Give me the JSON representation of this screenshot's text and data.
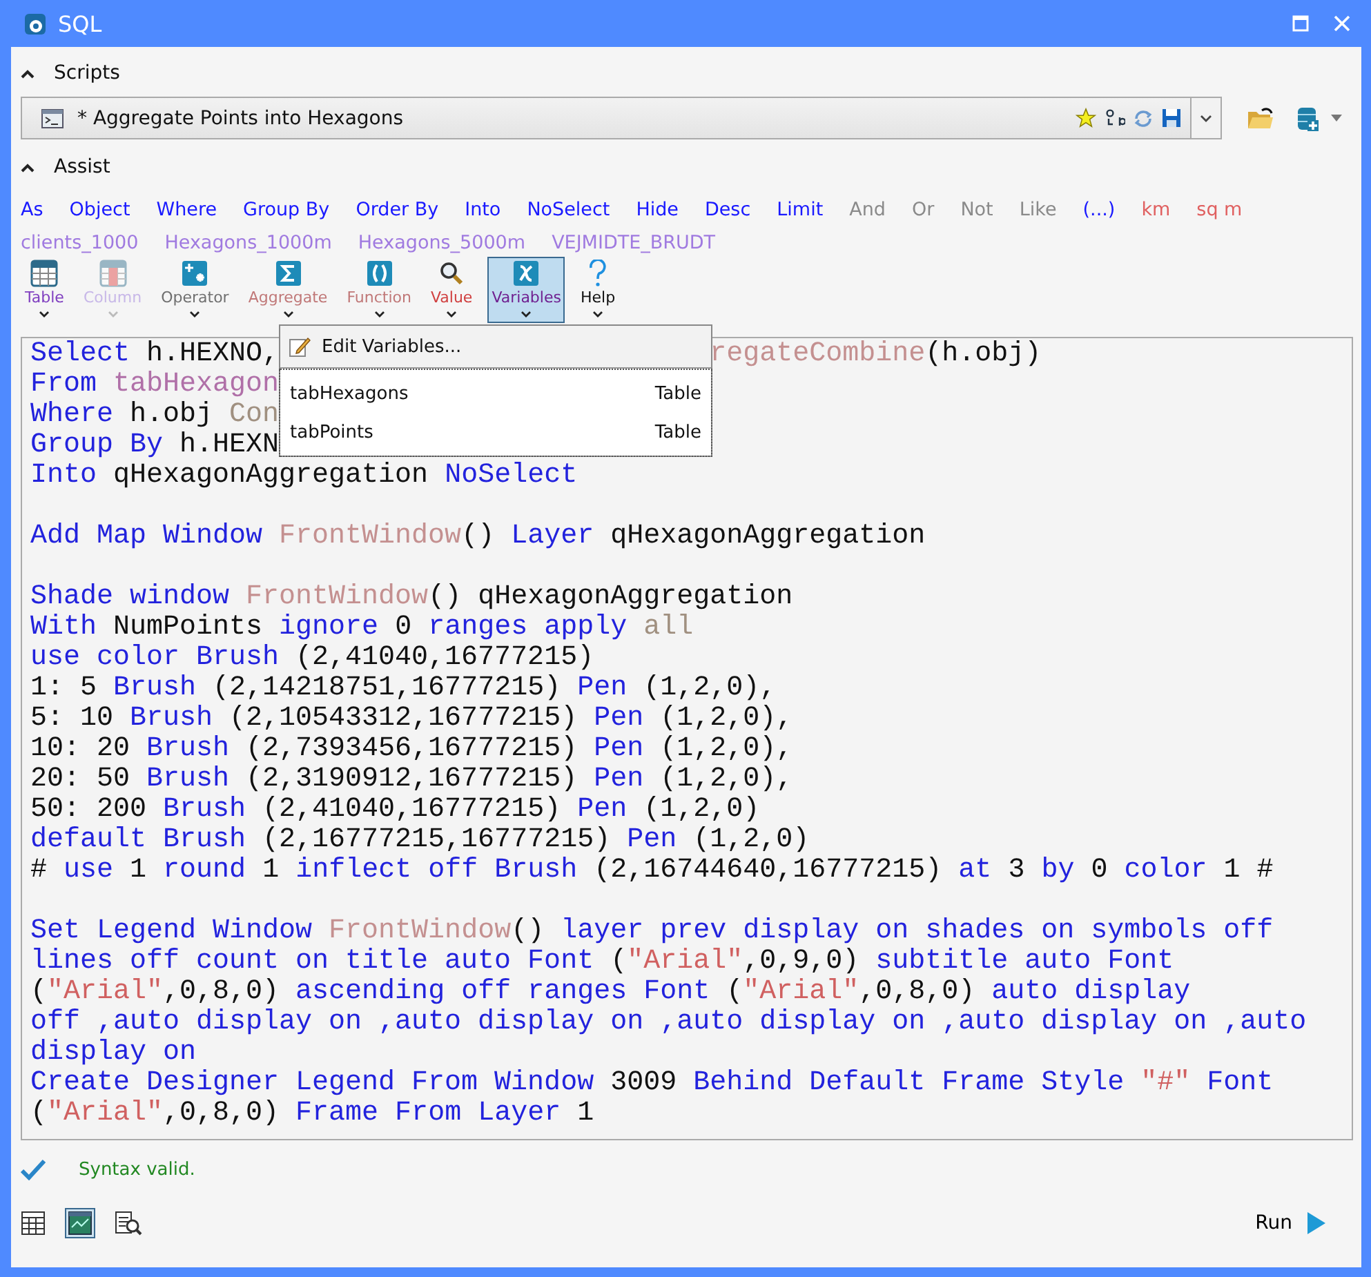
{
  "window": {
    "title": "SQL"
  },
  "scripts": {
    "label": "Scripts",
    "expanded": true,
    "current_script": "* Aggregate Points into Hexagons"
  },
  "assist": {
    "label": "Assist",
    "expanded": true,
    "keywords": [
      {
        "text": "As",
        "kind": "clause"
      },
      {
        "text": "Object",
        "kind": "clause"
      },
      {
        "text": "Where",
        "kind": "clause"
      },
      {
        "text": "Group By",
        "kind": "clause"
      },
      {
        "text": "Order By",
        "kind": "clause"
      },
      {
        "text": "Into",
        "kind": "clause"
      },
      {
        "text": "NoSelect",
        "kind": "clause"
      },
      {
        "text": "Hide",
        "kind": "clause"
      },
      {
        "text": "Desc",
        "kind": "clause"
      },
      {
        "text": "Limit",
        "kind": "clause"
      },
      {
        "text": "And",
        "kind": "logical"
      },
      {
        "text": "Or",
        "kind": "logical"
      },
      {
        "text": "Not",
        "kind": "logical"
      },
      {
        "text": "Like",
        "kind": "logical"
      },
      {
        "text": "(...)",
        "kind": "clause"
      },
      {
        "text": "km",
        "kind": "unit"
      },
      {
        "text": "sq m",
        "kind": "unit"
      }
    ],
    "tables": [
      "clients_1000",
      "Hexagons_1000m",
      "Hexagons_5000m",
      "VEJMIDTE_BRUDT"
    ],
    "tools": [
      {
        "label": "Table",
        "kind": "table",
        "disabled": false,
        "selected": false
      },
      {
        "label": "Column",
        "kind": "column",
        "disabled": true,
        "selected": false
      },
      {
        "label": "Operator",
        "kind": "operator",
        "disabled": false,
        "selected": false
      },
      {
        "label": "Aggregate",
        "kind": "aggregate",
        "disabled": false,
        "selected": false
      },
      {
        "label": "Function",
        "kind": "function",
        "disabled": false,
        "selected": false
      },
      {
        "label": "Value",
        "kind": "value",
        "disabled": false,
        "selected": false
      },
      {
        "label": "Variables",
        "kind": "variables",
        "disabled": false,
        "selected": true
      },
      {
        "label": "Help",
        "kind": "help",
        "disabled": false,
        "selected": false
      }
    ]
  },
  "variables_menu": {
    "edit_item": "Edit Variables...",
    "variables": [
      {
        "name": "tabHexagons",
        "type": "Table"
      },
      {
        "name": "tabPoints",
        "type": "Table"
      }
    ]
  },
  "editor": {
    "blocks": [
      [
        {
          "tokens": [
            {
              "text": "Select",
              "kind": "keyword"
            },
            {
              "text": " h.HEXNO,",
              "kind": "plain"
            }
          ],
          "tokens_right": [
            {
              "text": "regateCombine",
              "kind": "function"
            },
            {
              "text": "(h.obj)",
              "kind": "plain"
            }
          ]
        },
        {
          "tokens": [
            {
              "text": "From ",
              "kind": "keyword"
            },
            {
              "text": "tabHexagon",
              "kind": "table"
            }
          ]
        },
        {
          "tokens": [
            {
              "text": "Where",
              "kind": "keyword"
            },
            {
              "text": " h.obj ",
              "kind": "plain"
            },
            {
              "text": "Con",
              "kind": "operator"
            }
          ]
        },
        {
          "tokens": [
            {
              "text": "Group By",
              "kind": "keyword"
            },
            {
              "text": " h.HEXN",
              "kind": "plain"
            }
          ]
        },
        {
          "tokens": [
            {
              "text": "Into",
              "kind": "keyword"
            },
            {
              "text": " qHexagonAggregation ",
              "kind": "plain"
            },
            {
              "text": "NoSelect",
              "kind": "keyword"
            }
          ]
        }
      ],
      [
        {
          "tokens": [
            {
              "text": "Add Map Window ",
              "kind": "keyword"
            },
            {
              "text": "FrontWindow",
              "kind": "function"
            },
            {
              "text": "() ",
              "kind": "plain"
            },
            {
              "text": "Layer",
              "kind": "keyword"
            },
            {
              "text": " qHexagonAggregation",
              "kind": "plain"
            }
          ]
        }
      ],
      [
        {
          "tokens": [
            {
              "text": "Shade window ",
              "kind": "keyword"
            },
            {
              "text": "FrontWindow",
              "kind": "function"
            },
            {
              "text": "() qHexagonAggregation",
              "kind": "plain"
            }
          ]
        },
        {
          "tokens": [
            {
              "text": "With",
              "kind": "keyword"
            },
            {
              "text": " NumPoints ",
              "kind": "plain"
            },
            {
              "text": "ignore",
              "kind": "keyword"
            },
            {
              "text": " 0 ",
              "kind": "plain"
            },
            {
              "text": "ranges apply ",
              "kind": "keyword"
            },
            {
              "text": "all",
              "kind": "operator"
            }
          ]
        },
        {
          "tokens": [
            {
              "text": "use color Brush",
              "kind": "keyword"
            },
            {
              "text": " (2,41040,16777215)",
              "kind": "plain"
            }
          ]
        },
        {
          "tokens": [
            {
              "text": "1: 5 ",
              "kind": "plain"
            },
            {
              "text": "Brush",
              "kind": "keyword"
            },
            {
              "text": " (2,14218751,16777215) ",
              "kind": "plain"
            },
            {
              "text": "Pen",
              "kind": "keyword"
            },
            {
              "text": " (1,2,0),",
              "kind": "plain"
            }
          ]
        },
        {
          "tokens": [
            {
              "text": "5: 10 ",
              "kind": "plain"
            },
            {
              "text": "Brush",
              "kind": "keyword"
            },
            {
              "text": " (2,10543312,16777215) ",
              "kind": "plain"
            },
            {
              "text": "Pen",
              "kind": "keyword"
            },
            {
              "text": " (1,2,0),",
              "kind": "plain"
            }
          ]
        },
        {
          "tokens": [
            {
              "text": "10: 20 ",
              "kind": "plain"
            },
            {
              "text": "Brush",
              "kind": "keyword"
            },
            {
              "text": " (2,7393456,16777215) ",
              "kind": "plain"
            },
            {
              "text": "Pen",
              "kind": "keyword"
            },
            {
              "text": " (1,2,0),",
              "kind": "plain"
            }
          ]
        },
        {
          "tokens": [
            {
              "text": "20: 50 ",
              "kind": "plain"
            },
            {
              "text": "Brush",
              "kind": "keyword"
            },
            {
              "text": " (2,3190912,16777215) ",
              "kind": "plain"
            },
            {
              "text": "Pen",
              "kind": "keyword"
            },
            {
              "text": " (1,2,0),",
              "kind": "plain"
            }
          ]
        },
        {
          "tokens": [
            {
              "text": "50: 200 ",
              "kind": "plain"
            },
            {
              "text": "Brush",
              "kind": "keyword"
            },
            {
              "text": " (2,41040,16777215) ",
              "kind": "plain"
            },
            {
              "text": "Pen",
              "kind": "keyword"
            },
            {
              "text": " (1,2,0)",
              "kind": "plain"
            }
          ]
        },
        {
          "tokens": [
            {
              "text": "default Brush",
              "kind": "keyword"
            },
            {
              "text": " (2,16777215,16777215) ",
              "kind": "plain"
            },
            {
              "text": "Pen",
              "kind": "keyword"
            },
            {
              "text": " (1,2,0)",
              "kind": "plain"
            }
          ]
        },
        {
          "tokens": [
            {
              "text": "# ",
              "kind": "plain"
            },
            {
              "text": "use",
              "kind": "keyword"
            },
            {
              "text": " 1 ",
              "kind": "plain"
            },
            {
              "text": "round",
              "kind": "keyword"
            },
            {
              "text": " 1 ",
              "kind": "plain"
            },
            {
              "text": "inflect off Brush",
              "kind": "keyword"
            },
            {
              "text": " (2,16744640,16777215) ",
              "kind": "plain"
            },
            {
              "text": "at",
              "kind": "keyword"
            },
            {
              "text": " 3 ",
              "kind": "plain"
            },
            {
              "text": "by",
              "kind": "keyword"
            },
            {
              "text": " 0 ",
              "kind": "plain"
            },
            {
              "text": "color",
              "kind": "keyword"
            },
            {
              "text": " 1 #",
              "kind": "plain"
            }
          ]
        }
      ],
      [
        {
          "tokens": [
            {
              "text": "Set Legend Window ",
              "kind": "keyword"
            },
            {
              "text": "FrontWindow",
              "kind": "function"
            },
            {
              "text": "() ",
              "kind": "plain"
            },
            {
              "text": "layer prev display on shades on symbols off",
              "kind": "keyword"
            }
          ]
        },
        {
          "tokens": [
            {
              "text": "lines off count on title auto Font",
              "kind": "keyword"
            },
            {
              "text": " (",
              "kind": "plain"
            },
            {
              "text": "\"Arial\"",
              "kind": "string"
            },
            {
              "text": ",0,9,0) ",
              "kind": "plain"
            },
            {
              "text": "subtitle auto Font",
              "kind": "keyword"
            }
          ]
        },
        {
          "tokens": [
            {
              "text": "(",
              "kind": "plain"
            },
            {
              "text": "\"Arial\"",
              "kind": "string"
            },
            {
              "text": ",0,8,0) ",
              "kind": "plain"
            },
            {
              "text": "ascending off ranges Font",
              "kind": "keyword"
            },
            {
              "text": " (",
              "kind": "plain"
            },
            {
              "text": "\"Arial\"",
              "kind": "string"
            },
            {
              "text": ",0,8,0) ",
              "kind": "plain"
            },
            {
              "text": "auto display",
              "kind": "keyword"
            }
          ]
        },
        {
          "tokens": [
            {
              "text": "off ,auto display on ,auto display on ,auto display on ,auto display on ,auto",
              "kind": "keyword"
            }
          ]
        },
        {
          "tokens": [
            {
              "text": "display on",
              "kind": "keyword"
            }
          ]
        },
        {
          "tokens": [
            {
              "text": "Create Designer Legend From Window",
              "kind": "keyword"
            },
            {
              "text": " 3009 ",
              "kind": "plain"
            },
            {
              "text": "Behind Default Frame Style ",
              "kind": "keyword"
            },
            {
              "text": "\"#\"",
              "kind": "string"
            },
            {
              "text": " Font",
              "kind": "keyword"
            }
          ]
        },
        {
          "tokens": [
            {
              "text": "(",
              "kind": "plain"
            },
            {
              "text": "\"Arial\"",
              "kind": "string"
            },
            {
              "text": ",0,8,0) ",
              "kind": "plain"
            },
            {
              "text": "Frame From Layer",
              "kind": "keyword"
            },
            {
              "text": " 1",
              "kind": "plain"
            }
          ]
        }
      ]
    ]
  },
  "status": {
    "valid": true,
    "message": "Syntax valid."
  },
  "run_button": "Run"
}
